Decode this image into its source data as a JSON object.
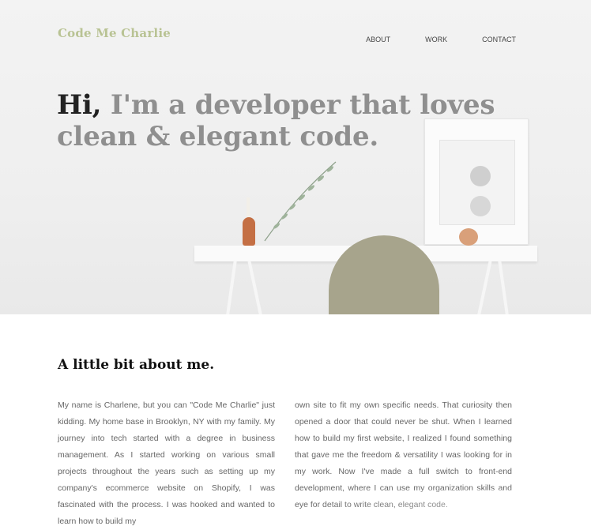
{
  "brand": {
    "name": "Code Me Charlie"
  },
  "nav": {
    "items": [
      "ABOUT",
      "WORK",
      "CONTACT"
    ]
  },
  "hero": {
    "greeting": "Hi,",
    "headline": "I'm a developer that loves clean & elegant code."
  },
  "about": {
    "title": "A little bit about me.",
    "paragraph_left": "My name is Charlene, but you can \"Code Me Charlie\" just kidding. My home base in Brooklyn, NY with my family. My journey into tech started with a degree in business management. As I started working on various small projects throughout the years such as setting up my company's ecommerce website on Shopify, I was fascinated with the process. I was hooked and wanted to learn how to build my",
    "paragraph_right": "own site to fit my own specific needs. That curiosity then opened a door that could never be shut. When I learned how to build my first website, I realized I found something that gave me the freedom & versatility I was looking for in my work. Now I've made a full switch to front-end development, where I can use my organization skills and eye for detail to write clean, elegant code."
  },
  "colors": {
    "brand": "#b9c394",
    "headline_gray": "#8f8f8f",
    "text": "#666666"
  }
}
